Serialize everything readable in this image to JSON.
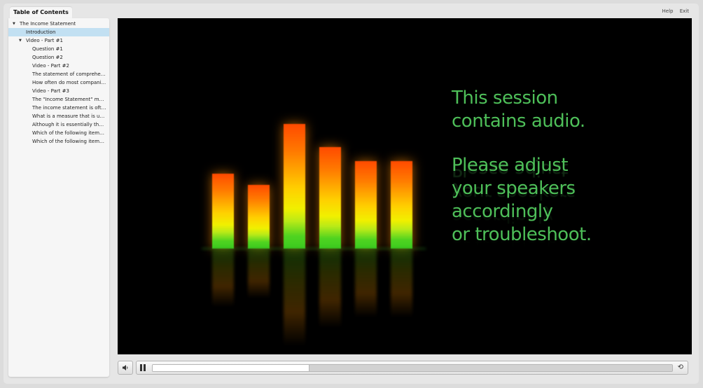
{
  "sidebar": {
    "tab_label": "Table of Contents",
    "items": [
      {
        "label": "The Income Statement",
        "level": 0,
        "expanded": true,
        "selected": false
      },
      {
        "label": "Introduction",
        "level": 1,
        "expanded": false,
        "selected": true
      },
      {
        "label": "Video - Part #1",
        "level": 1,
        "expanded": true,
        "selected": false
      },
      {
        "label": "Question #1",
        "level": 2,
        "selected": false
      },
      {
        "label": "Question #2",
        "level": 2,
        "selected": false
      },
      {
        "label": "Video - Part #2",
        "level": 2,
        "selected": false
      },
      {
        "label": "The statement of comprehen...",
        "level": 2,
        "selected": false
      },
      {
        "label": "How often do most compani...",
        "level": 2,
        "selected": false
      },
      {
        "label": "Video - Part #3",
        "level": 2,
        "selected": false
      },
      {
        "label": "The \"Income Statement\" me...",
        "level": 2,
        "selected": false
      },
      {
        "label": "The income statement is ofte...",
        "level": 2,
        "selected": false
      },
      {
        "label": "What is a measure that is use...",
        "level": 2,
        "selected": false
      },
      {
        "label": "Although it is essentially the ...",
        "level": 2,
        "selected": false
      },
      {
        "label": "Which of the following items...",
        "level": 2,
        "selected": false
      },
      {
        "label": "Which of the following items...",
        "level": 2,
        "selected": false
      }
    ]
  },
  "header": {
    "help_label": "Help",
    "exit_label": "Exit"
  },
  "video": {
    "message_line1": "This session",
    "message_line2": "contains audio.",
    "message_line3": "Please adjust",
    "message_line4": "your speakers",
    "message_line5": "accordingly",
    "message_line6": "or troubleshoot.",
    "equalizer_levels": [
      0.54,
      0.46,
      0.9,
      0.73,
      0.63,
      0.63
    ],
    "text_color": "#4ebf59"
  },
  "controls": {
    "mute_icon": "speaker-icon",
    "play_pause_icon": "pause-icon",
    "replay_icon": "replay-icon",
    "progress_fraction": 0.3
  }
}
